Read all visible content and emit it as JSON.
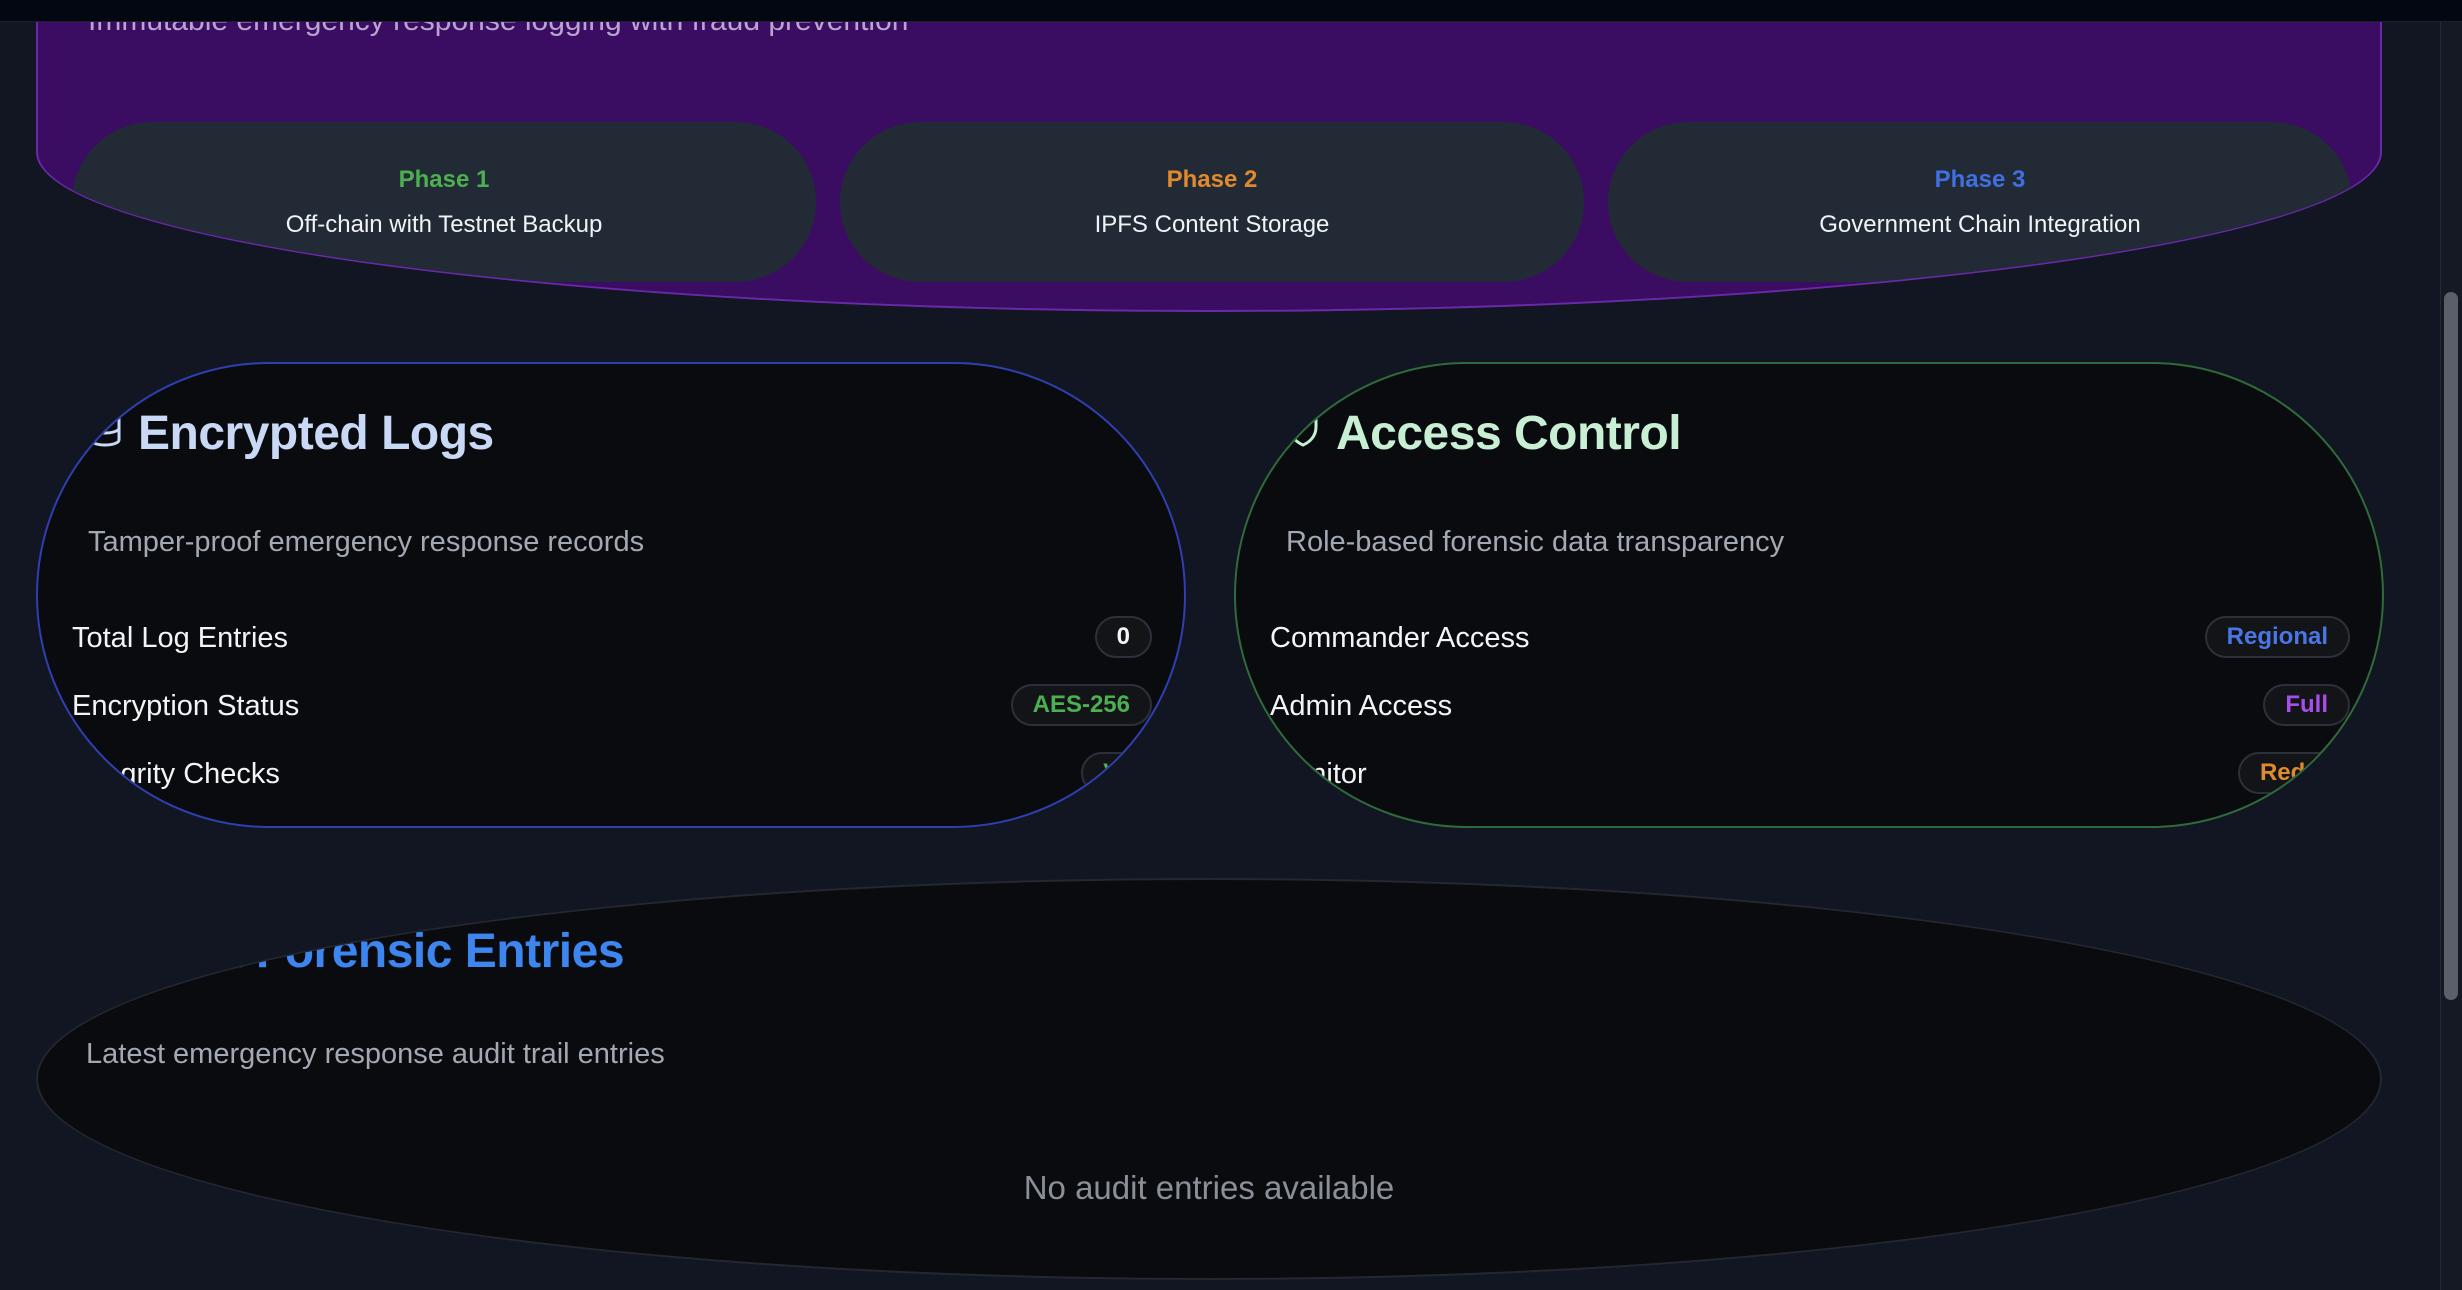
{
  "hero": {
    "subtitle": "Immutable emergency response logging with fraud prevention",
    "phases": [
      {
        "title": "Phase 1",
        "text": "Off-chain with Testnet Backup",
        "color": "#4caf50"
      },
      {
        "title": "Phase 2",
        "text": "IPFS Content Storage",
        "color": "#e08a2e"
      },
      {
        "title": "Phase 3",
        "text": "Government Chain Integration",
        "color": "#3f6fe0"
      }
    ]
  },
  "logs_card": {
    "icon": "database-icon",
    "title": "Encrypted Logs",
    "description": "Tamper-proof emergency response records",
    "rows": [
      {
        "label": "Total Log Entries",
        "value": "0"
      },
      {
        "label": "Encryption Status",
        "value": "AES-256"
      },
      {
        "label": "Integrity Checks",
        "value": "Verified"
      }
    ]
  },
  "access_card": {
    "icon": "shield-icon",
    "title": "Access Control",
    "description": "Role-based forensic data transparency",
    "rows": [
      {
        "label": "Commander Access",
        "value": "Regional"
      },
      {
        "label": "Admin Access",
        "value": "Full"
      },
      {
        "label": "Monitor",
        "value": "Redacted"
      }
    ]
  },
  "recent": {
    "title": "Recent Forensic Entries",
    "description": "Latest emergency response audit trail entries",
    "empty_text": "No audit entries available"
  },
  "colors": {
    "background": "#111622",
    "hero_bg": "#3a0d63",
    "card_bg": "#0a0b0e",
    "accent_blue": "#3d86f0"
  }
}
